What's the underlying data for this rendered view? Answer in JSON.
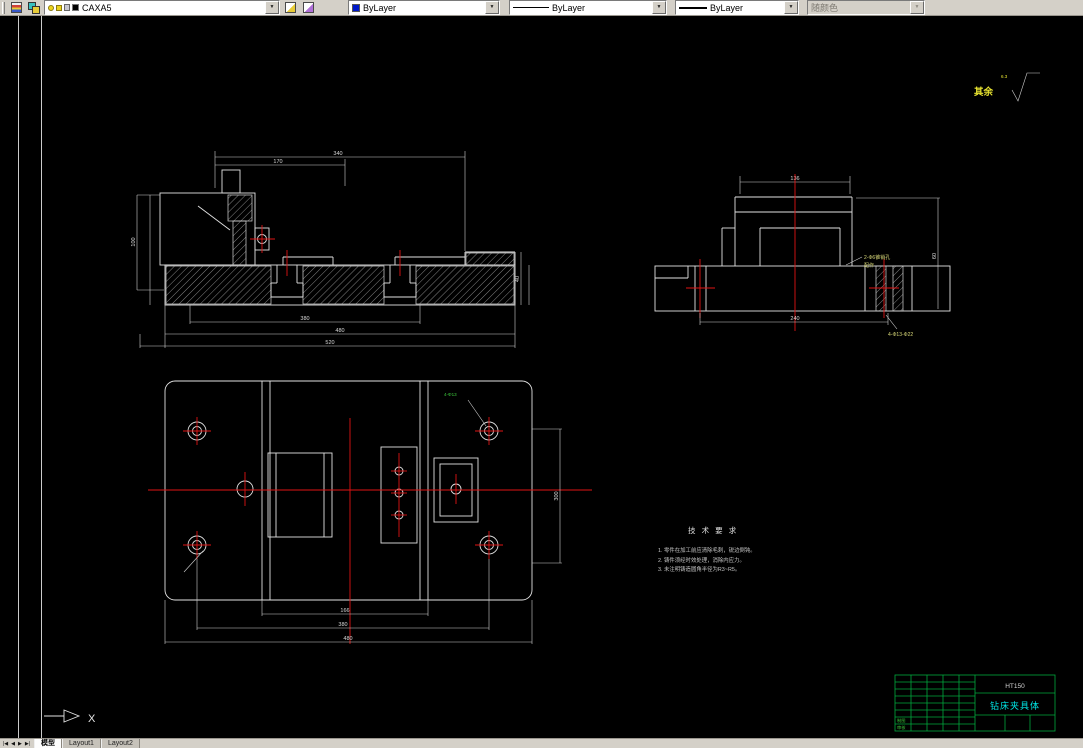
{
  "toolbar": {
    "layer": {
      "name": "CAXA5"
    },
    "color": {
      "value": "ByLayer",
      "swatch_color": "#0018c8"
    },
    "linetype": {
      "value": "ByLayer"
    },
    "lineweight": {
      "value": "ByLayer"
    },
    "plot_style": {
      "value": "随颜色"
    },
    "icons": {
      "dropdown_arrow": "▼",
      "layers": "layers-icon",
      "layer_states": "layer-states-icon",
      "make_object_layer_current": "make-object-layer-current-icon",
      "layer_previous": "layer-previous-icon"
    }
  },
  "drawing": {
    "surface_note": {
      "prefix": "其余",
      "roughness": "6.3"
    },
    "tech": {
      "title": "技 术 要 求",
      "note1": "1. 零件在加工前应清除毛刺，锐边倒钝。",
      "note2": "2. 铸件须经时效处理，消除内应力。",
      "note3": "3. 未注明铸造圆角半径为R3~R5。"
    },
    "leaders": {
      "pin": "2-Φ6锥销孔",
      "pin2": "配作",
      "cbore": "4-Φ13-Φ22",
      "corner_note": "4-Φ13"
    },
    "dims": {
      "front_top": "340",
      "front_top2": "170",
      "front_left": "100",
      "front_w1": "380",
      "front_w2": "480",
      "front_w3": "520",
      "front_r1": "40",
      "side_top": "136",
      "side_right": "60",
      "side_bottom": "240",
      "plan_inner": "166",
      "plan_mid": "380",
      "plan_total": "480",
      "plan_right": "300"
    },
    "title_block": {
      "material": "HT150",
      "part_name": "钻床夹具体",
      "row1": "制图",
      "row2": "审核"
    },
    "ucs": {
      "x_label": "X"
    }
  },
  "tabs": {
    "nav_first": "|◀",
    "nav_prev": "◀",
    "nav_next": "▶",
    "nav_last": "▶|",
    "model": "模型",
    "layout1": "Layout1",
    "layout2": "Layout2"
  }
}
